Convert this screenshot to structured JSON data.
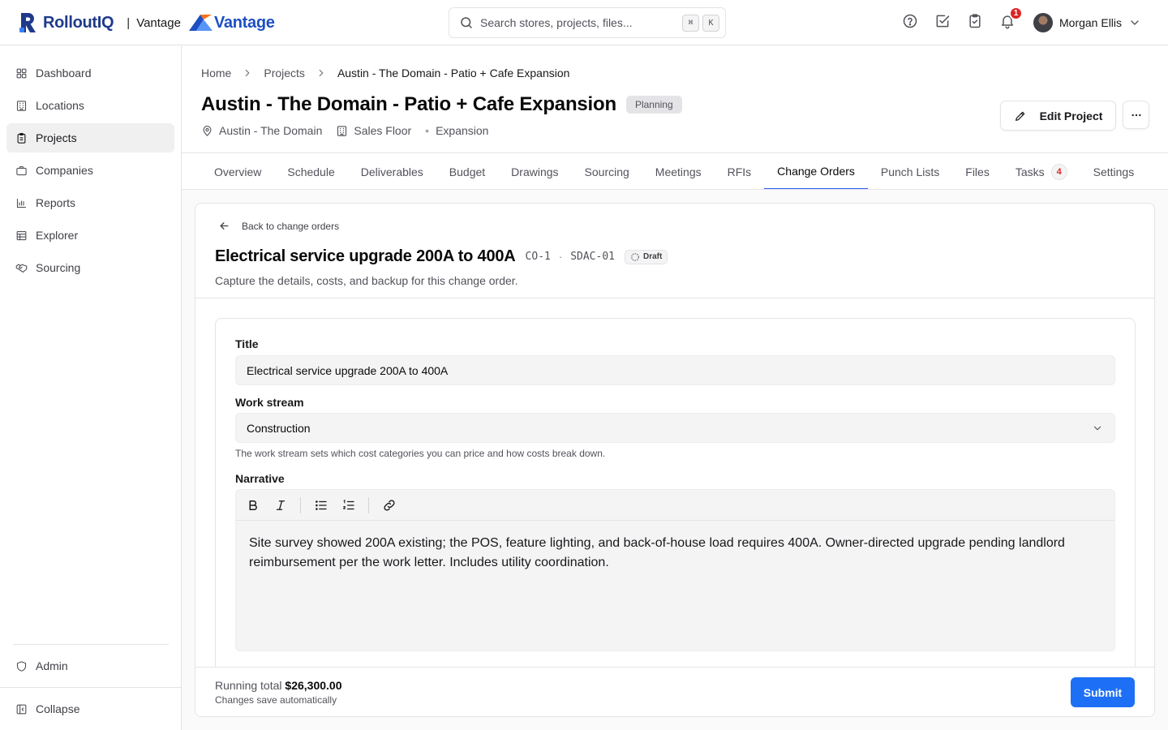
{
  "app": {
    "brand_name": "RolloutIQ",
    "brand_separator": "|",
    "workspace": "Vantage",
    "workspace_logo": "Vantage",
    "brand_color": "#1f3a8a",
    "accent_color": "#2563eb"
  },
  "search": {
    "placeholder": "Search stores, projects, files...",
    "value": "",
    "shortcut_keys": [
      "⌘",
      "K"
    ]
  },
  "header_icons": {
    "help": "help-circle-icon",
    "tasks": "check-square-icon",
    "clipboard": "clipboard-check-icon",
    "notifications": "bell-icon",
    "notification_count": "1"
  },
  "user": {
    "name": "Morgan Ellis"
  },
  "sidebar": {
    "items": [
      {
        "label": "Dashboard",
        "icon": "grid-icon",
        "active": false
      },
      {
        "label": "Locations",
        "icon": "building-icon",
        "active": false
      },
      {
        "label": "Projects",
        "icon": "clipboard-icon",
        "active": true
      },
      {
        "label": "Companies",
        "icon": "briefcase-icon",
        "active": false
      },
      {
        "label": "Reports",
        "icon": "bar-chart-icon",
        "active": false
      },
      {
        "label": "Explorer",
        "icon": "table-icon",
        "active": false
      },
      {
        "label": "Sourcing",
        "icon": "handshake-icon",
        "active": false
      }
    ],
    "admin_label": "Admin",
    "collapse_label": "Collapse"
  },
  "breadcrumb": [
    "Home",
    "Projects",
    "Austin - The Domain - Patio + Cafe Expansion"
  ],
  "project": {
    "title": "Austin - The Domain - Patio + Cafe Expansion",
    "status": "Planning",
    "location": "Austin - The Domain",
    "area": "Sales Floor",
    "type": "Expansion",
    "edit_label": "Edit Project"
  },
  "tabs": [
    {
      "label": "Overview"
    },
    {
      "label": "Schedule"
    },
    {
      "label": "Deliverables"
    },
    {
      "label": "Budget"
    },
    {
      "label": "Drawings"
    },
    {
      "label": "Sourcing"
    },
    {
      "label": "Meetings"
    },
    {
      "label": "RFIs"
    },
    {
      "label": "Change Orders",
      "active": true
    },
    {
      "label": "Punch Lists"
    },
    {
      "label": "Files"
    },
    {
      "label": "Tasks",
      "badge": "4"
    },
    {
      "label": "Settings"
    }
  ],
  "change_order": {
    "back_label": "Back to change orders",
    "title": "Electrical service upgrade 200A to 400A",
    "code": "CO-1",
    "separator": "·",
    "store_code": "SDAC-01",
    "status": "Draft",
    "subtitle": "Capture the details, costs, and backup for this change order."
  },
  "form": {
    "title_label": "Title",
    "title_value": "Electrical service upgrade 200A to 400A",
    "work_stream_label": "Work stream",
    "work_stream_value": "Construction",
    "work_stream_help": "The work stream sets which cost categories you can price and how costs break down.",
    "narrative_label": "Narrative",
    "narrative_text": "Site survey showed 200A existing; the POS, feature lighting, and back-of-house load requires 400A. Owner-directed upgrade pending landlord reimbursement per the work letter. Includes utility coordination."
  },
  "footer": {
    "running_total_label": "Running total",
    "running_total_value": "$26,300.00",
    "autosave_note": "Changes save automatically",
    "submit_label": "Submit",
    "submit_color": "#1d6ff5"
  }
}
